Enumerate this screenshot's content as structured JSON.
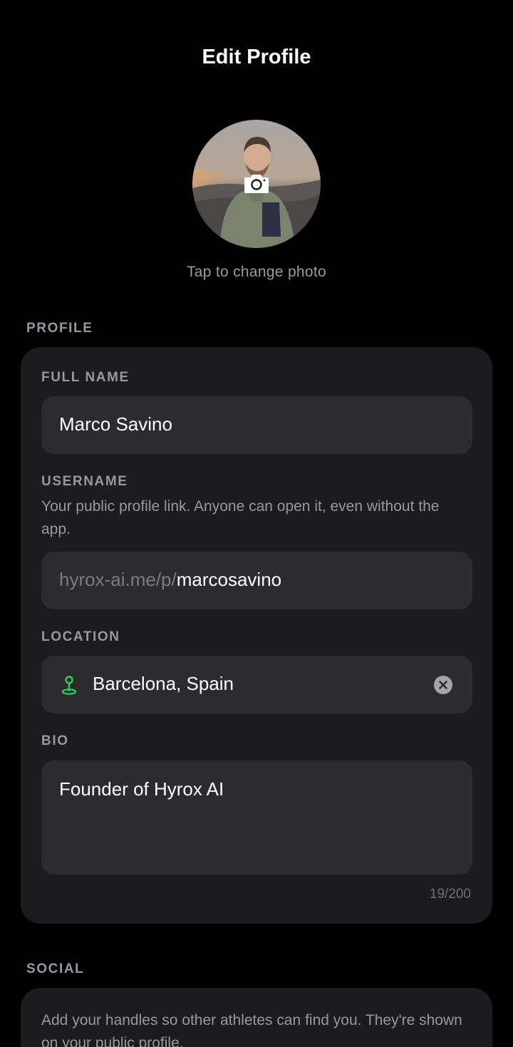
{
  "header": {
    "title": "Edit Profile"
  },
  "avatar": {
    "change_label": "Tap to change photo"
  },
  "profile_section": {
    "label": "PROFILE",
    "full_name": {
      "label": "FULL NAME",
      "value": "Marco Savino"
    },
    "username": {
      "label": "USERNAME",
      "helper": "Your public profile link. Anyone can open it, even without the app.",
      "prefix": "hyrox-ai.me/p/",
      "value": "marcosavino"
    },
    "location": {
      "label": "LOCATION",
      "value": "Barcelona, Spain",
      "icon": "location-pin-icon"
    },
    "bio": {
      "label": "BIO",
      "value": "Founder of Hyrox AI",
      "counter": "19/200"
    }
  },
  "social_section": {
    "label": "SOCIAL",
    "description": "Add your handles so other athletes can find you. They're shown on your public profile."
  },
  "colors": {
    "background": "#000000",
    "card": "#1c1c1e",
    "input": "#2c2c2e",
    "accent": "#30d158"
  }
}
